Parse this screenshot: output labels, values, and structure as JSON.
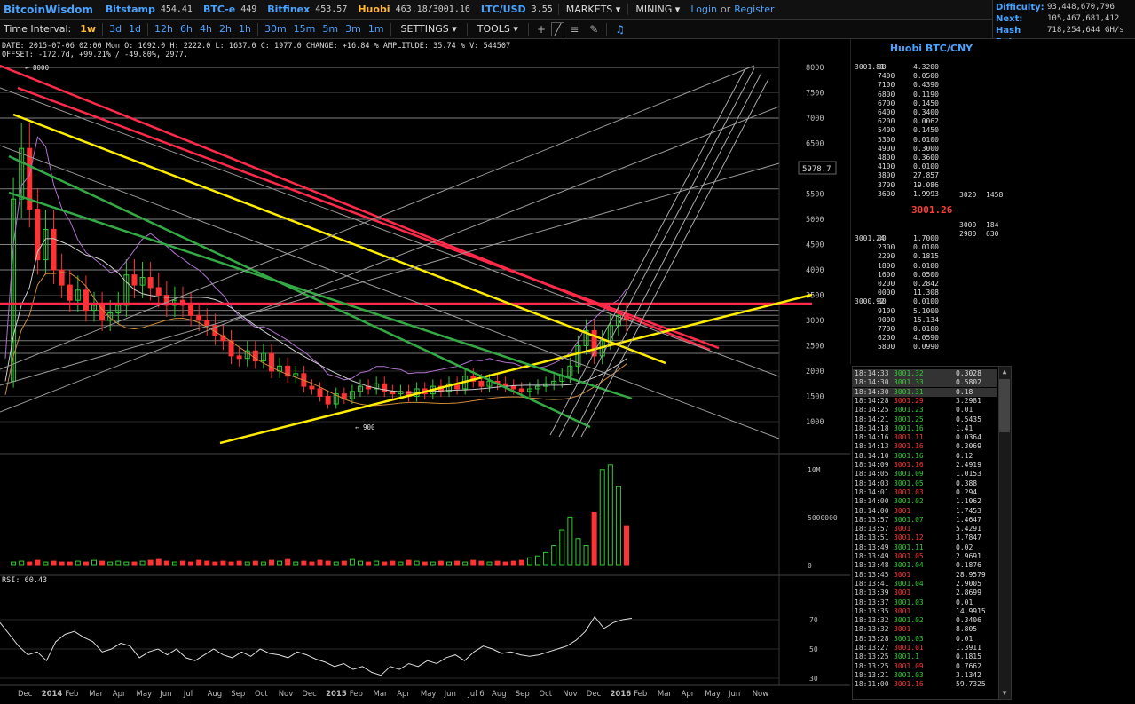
{
  "header": {
    "brand": "BitcoinWisdom",
    "exchanges": [
      {
        "name": "Bitstamp",
        "price": "454.41",
        "highlight": false
      },
      {
        "name": "BTC-e",
        "price": "449",
        "highlight": false
      },
      {
        "name": "Bitfinex",
        "price": "453.57",
        "highlight": false
      },
      {
        "name": "Huobi",
        "price": "463.18/3001.16",
        "highlight": true
      },
      {
        "name": "LTC/USD",
        "price": "3.55",
        "highlight": false
      }
    ],
    "menus": [
      "MARKETS",
      "MINING"
    ],
    "login": "Login",
    "or": "or",
    "register": "Register"
  },
  "network": {
    "difficulty_label": "Difficulty:",
    "difficulty": "93,448,670,796",
    "next_label": "Next:",
    "next": "105,467,681,412",
    "hashrate_label": "Hash Rate:",
    "hashrate": "718,254,644 GH/s"
  },
  "toolbar": {
    "interval_label": "Time Interval:",
    "intervals": [
      "1w",
      "3d",
      "1d",
      "12h",
      "6h",
      "4h",
      "2h",
      "1h",
      "30m",
      "15m",
      "5m",
      "3m",
      "1m"
    ],
    "active_interval": "1w",
    "settings": "SETTINGS",
    "tools": "TOOLS"
  },
  "chart_info": {
    "line1": "DATE: 2015-07-06 02:00 Mon    O: 1692.0    H: 2222.0    L: 1637.0    C: 1977.0    CHANGE: +16.84 %    AMPLITUDE: 35.74 %    V: 544507",
    "line2": "OFFSET: -172.7d, +99.21% / -49.80%, 2977."
  },
  "chart_data": {
    "type": "line",
    "price_axis": [
      1000,
      1500,
      2000,
      2500,
      3000,
      3500,
      4000,
      4500,
      5000,
      5500,
      6000,
      6500,
      7000,
      7500,
      8000
    ],
    "price_ylim": [
      500,
      8000
    ],
    "current_price_tag": "5978.7",
    "high_marker": "8000",
    "low_marker": "900",
    "volume_axis": [
      "10M",
      "5000000",
      "0"
    ],
    "rsi_label": "RSI: 60.43",
    "rsi_axis": [
      70,
      50,
      30
    ],
    "x_labels": [
      "Dec",
      "2014",
      "Feb",
      "Mar",
      "Apr",
      "May",
      "Jun",
      "Jul",
      "Aug",
      "Sep",
      "Oct",
      "Nov",
      "Dec",
      "2015",
      "Feb",
      "Mar",
      "Apr",
      "May",
      "Jun",
      "Jul 6",
      "Aug",
      "Sep",
      "Oct",
      "Nov",
      "Dec",
      "2016",
      "Feb",
      "Mar",
      "Apr",
      "May",
      "Jun",
      "Now"
    ],
    "closes": [
      1800,
      5400,
      6400,
      5200,
      4200,
      4800,
      4000,
      3700,
      3400,
      3600,
      3200,
      3300,
      3000,
      3150,
      3300,
      3900,
      3700,
      3850,
      3650,
      3500,
      3300,
      3400,
      3300,
      3100,
      3000,
      2900,
      2700,
      2600,
      2300,
      2250,
      2400,
      2200,
      2350,
      2000,
      2100,
      1900,
      1950,
      1700,
      1650,
      1500,
      1350,
      1550,
      1450,
      1600,
      1700,
      1650,
      1750,
      1600,
      1550,
      1600,
      1500,
      1650,
      1550,
      1700,
      1600,
      1750,
      1650,
      1900,
      1800,
      1700,
      1800,
      1750,
      1700,
      1650,
      1600,
      1650,
      1700,
      1750,
      1800,
      1900,
      2100,
      2500,
      2800,
      2300,
      2600,
      2900,
      3100,
      3000
    ],
    "volumes": [
      3,
      4,
      3,
      5,
      3,
      4,
      3,
      3,
      4,
      3,
      5,
      4,
      3,
      4,
      3,
      3,
      4,
      5,
      6,
      4,
      3,
      4,
      3,
      5,
      4,
      3,
      4,
      3,
      4,
      3,
      4,
      3,
      5,
      4,
      6,
      3,
      4,
      3,
      5,
      4,
      3,
      4,
      6,
      4,
      3,
      4,
      3,
      4,
      3,
      5,
      4,
      3,
      3,
      4,
      3,
      4,
      3,
      5,
      4,
      3,
      4,
      3,
      4,
      5,
      8,
      10,
      14,
      22,
      40,
      55,
      30,
      22,
      60,
      110,
      115,
      90,
      45
    ],
    "rsi": [
      68,
      60,
      52,
      46,
      48,
      42,
      55,
      60,
      62,
      58,
      55,
      48,
      50,
      54,
      52,
      44,
      48,
      50,
      46,
      50,
      44,
      42,
      46,
      50,
      46,
      44,
      48,
      45,
      50,
      47,
      46,
      44,
      48,
      46,
      43,
      41,
      38,
      40,
      36,
      38,
      34,
      32,
      38,
      36,
      40,
      38,
      42,
      40,
      44,
      46,
      42,
      48,
      52,
      50,
      47,
      48,
      46,
      45,
      46,
      48,
      50,
      52,
      56,
      62,
      72,
      64,
      68,
      70,
      71
    ]
  },
  "orderbook": {
    "title": "Huobi BTC/CNY",
    "mid_price": "3001.26",
    "asks": [
      [
        "3001.81",
        "00",
        "4.3200"
      ],
      [
        "",
        "7400",
        "0.0500"
      ],
      [
        "",
        "7100",
        "0.4390"
      ],
      [
        "",
        "6800",
        "0.1190"
      ],
      [
        "",
        "6700",
        "0.1450"
      ],
      [
        "",
        "6400",
        "0.3400"
      ],
      [
        "",
        "6200",
        "0.0062"
      ],
      [
        "",
        "5400",
        "0.1450"
      ],
      [
        "",
        "5300",
        "0.0100"
      ],
      [
        "",
        "4900",
        "0.3000"
      ],
      [
        "",
        "4800",
        "0.3600"
      ],
      [
        "",
        "4100",
        "0.0100"
      ],
      [
        "",
        "3800",
        "27.857"
      ],
      [
        "",
        "3700",
        "19.086"
      ],
      [
        "",
        "3600",
        "1.9993"
      ]
    ],
    "bids": [
      [
        "3001.24",
        "00",
        "1.7000"
      ],
      [
        "",
        "2300",
        "0.0100"
      ],
      [
        "",
        "2200",
        "0.1815"
      ],
      [
        "",
        "1800",
        "0.0100"
      ],
      [
        "",
        "1600",
        "0.0500"
      ],
      [
        "",
        "0200",
        "0.2842"
      ],
      [
        "",
        "0000",
        "11.308"
      ],
      [
        "3000.92",
        "00",
        "0.0100"
      ],
      [
        "",
        "9100",
        "5.1000"
      ],
      [
        "",
        "9000",
        "15.134"
      ],
      [
        "",
        "7700",
        "0.0100"
      ],
      [
        "",
        "6200",
        "4.0590"
      ],
      [
        "",
        "5800",
        "0.0990"
      ]
    ],
    "side": [
      [
        "3020",
        "1458"
      ],
      [
        "3000",
        "184"
      ],
      [
        "2980",
        "630"
      ]
    ]
  },
  "trades": [
    [
      "18:14:33",
      "3001.32",
      "0.3028",
      "g"
    ],
    [
      "18:14:30",
      "3001.33",
      "0.5802",
      "g"
    ],
    [
      "18:14:30",
      "3001.31",
      "0.18",
      "g"
    ],
    [
      "18:14:28",
      "3001.29",
      "3.2981",
      "r"
    ],
    [
      "18:14:25",
      "3001.23",
      "0.01",
      "g"
    ],
    [
      "18:14:21",
      "3001.25",
      "0.5435",
      "g"
    ],
    [
      "18:14:18",
      "3001.16",
      "1.41",
      "g"
    ],
    [
      "18:14:16",
      "3001.11",
      "0.0364",
      "r"
    ],
    [
      "18:14:13",
      "3001.16",
      "0.3069",
      "r"
    ],
    [
      "18:14:10",
      "3001.16",
      "0.12",
      "g"
    ],
    [
      "18:14:09",
      "3001.16",
      "2.4919",
      "r"
    ],
    [
      "18:14:05",
      "3001.09",
      "1.0153",
      "g"
    ],
    [
      "18:14:03",
      "3001.05",
      "0.388",
      "g"
    ],
    [
      "18:14:01",
      "3001.03",
      "0.294",
      "r"
    ],
    [
      "18:14:00",
      "3001.02",
      "1.1062",
      "g"
    ],
    [
      "18:14:00",
      "3001",
      "1.7453",
      "r"
    ],
    [
      "18:13:57",
      "3001.07",
      "1.4647",
      "g"
    ],
    [
      "18:13:57",
      "3001",
      "5.4291",
      "r"
    ],
    [
      "18:13:51",
      "3001.12",
      "3.7847",
      "r"
    ],
    [
      "18:13:49",
      "3001.11",
      "0.02",
      "g"
    ],
    [
      "18:13:49",
      "3001.05",
      "2.9691",
      "r"
    ],
    [
      "18:13:48",
      "3001.04",
      "0.1876",
      "g"
    ],
    [
      "18:13:45",
      "3001",
      "28.9579",
      "r"
    ],
    [
      "18:13:41",
      "3001.04",
      "2.9005",
      "g"
    ],
    [
      "18:13:39",
      "3001",
      "2.8699",
      "r"
    ],
    [
      "18:13:37",
      "3001.03",
      "0.01",
      "g"
    ],
    [
      "18:13:35",
      "3001",
      "14.9915",
      "r"
    ],
    [
      "18:13:32",
      "3001.02",
      "0.3406",
      "g"
    ],
    [
      "18:13:32",
      "3001",
      "8.805",
      "r"
    ],
    [
      "18:13:28",
      "3001.03",
      "0.01",
      "g"
    ],
    [
      "18:13:27",
      "3001.01",
      "1.3911",
      "r"
    ],
    [
      "18:13:25",
      "3001.1",
      "0.1815",
      "g"
    ],
    [
      "18:13:25",
      "3001.09",
      "0.7662",
      "r"
    ],
    [
      "18:13:21",
      "3001.03",
      "3.1342",
      "g"
    ],
    [
      "18:11:00",
      "3001.16",
      "59.7325",
      "r"
    ]
  ],
  "colors": {
    "up": "#33cc33",
    "down": "#ff3333",
    "accent": "#4aa3ff",
    "active": "#ffb833"
  }
}
